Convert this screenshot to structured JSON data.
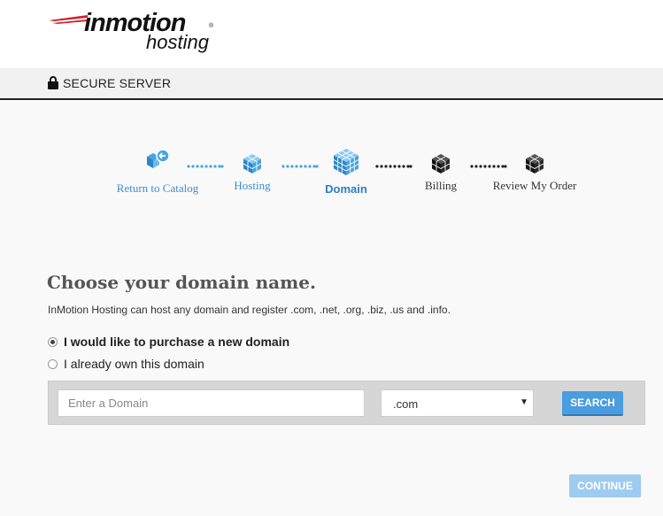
{
  "brand": {
    "name": "inmotion",
    "registered_mark": "®",
    "subname": "hosting",
    "colors": {
      "swoosh": "#d0202a",
      "text": "#111111"
    }
  },
  "secure_bar": {
    "icon": "lock-icon",
    "text": "SECURE SERVER"
  },
  "steps": [
    {
      "label": "Return to Catalog",
      "icon": "catalog-return-icon",
      "state": "done"
    },
    {
      "label": "Hosting",
      "icon": "cube-icon",
      "state": "done"
    },
    {
      "label": "Domain",
      "icon": "cube-icon",
      "state": "active"
    },
    {
      "label": "Billing",
      "icon": "cube-icon",
      "state": "pending"
    },
    {
      "label": "Review My Order",
      "icon": "cube-icon",
      "state": "pending"
    }
  ],
  "step_colors": {
    "done": "#4aa3df",
    "active": "#2d7fbf",
    "pending": "#222222"
  },
  "domain": {
    "title": "Choose your domain name.",
    "description": "InMotion Hosting can host any domain and register .com, .net, .org, .biz, .us and .info.",
    "options": [
      {
        "label": "I would like to purchase a new domain",
        "checked": true
      },
      {
        "label": "I already own this domain",
        "checked": false
      }
    ],
    "search": {
      "placeholder": "Enter a Domain",
      "value": "",
      "tld_selected": ".com",
      "button_label": "SEARCH"
    }
  },
  "continue_label": "CONTINUE"
}
